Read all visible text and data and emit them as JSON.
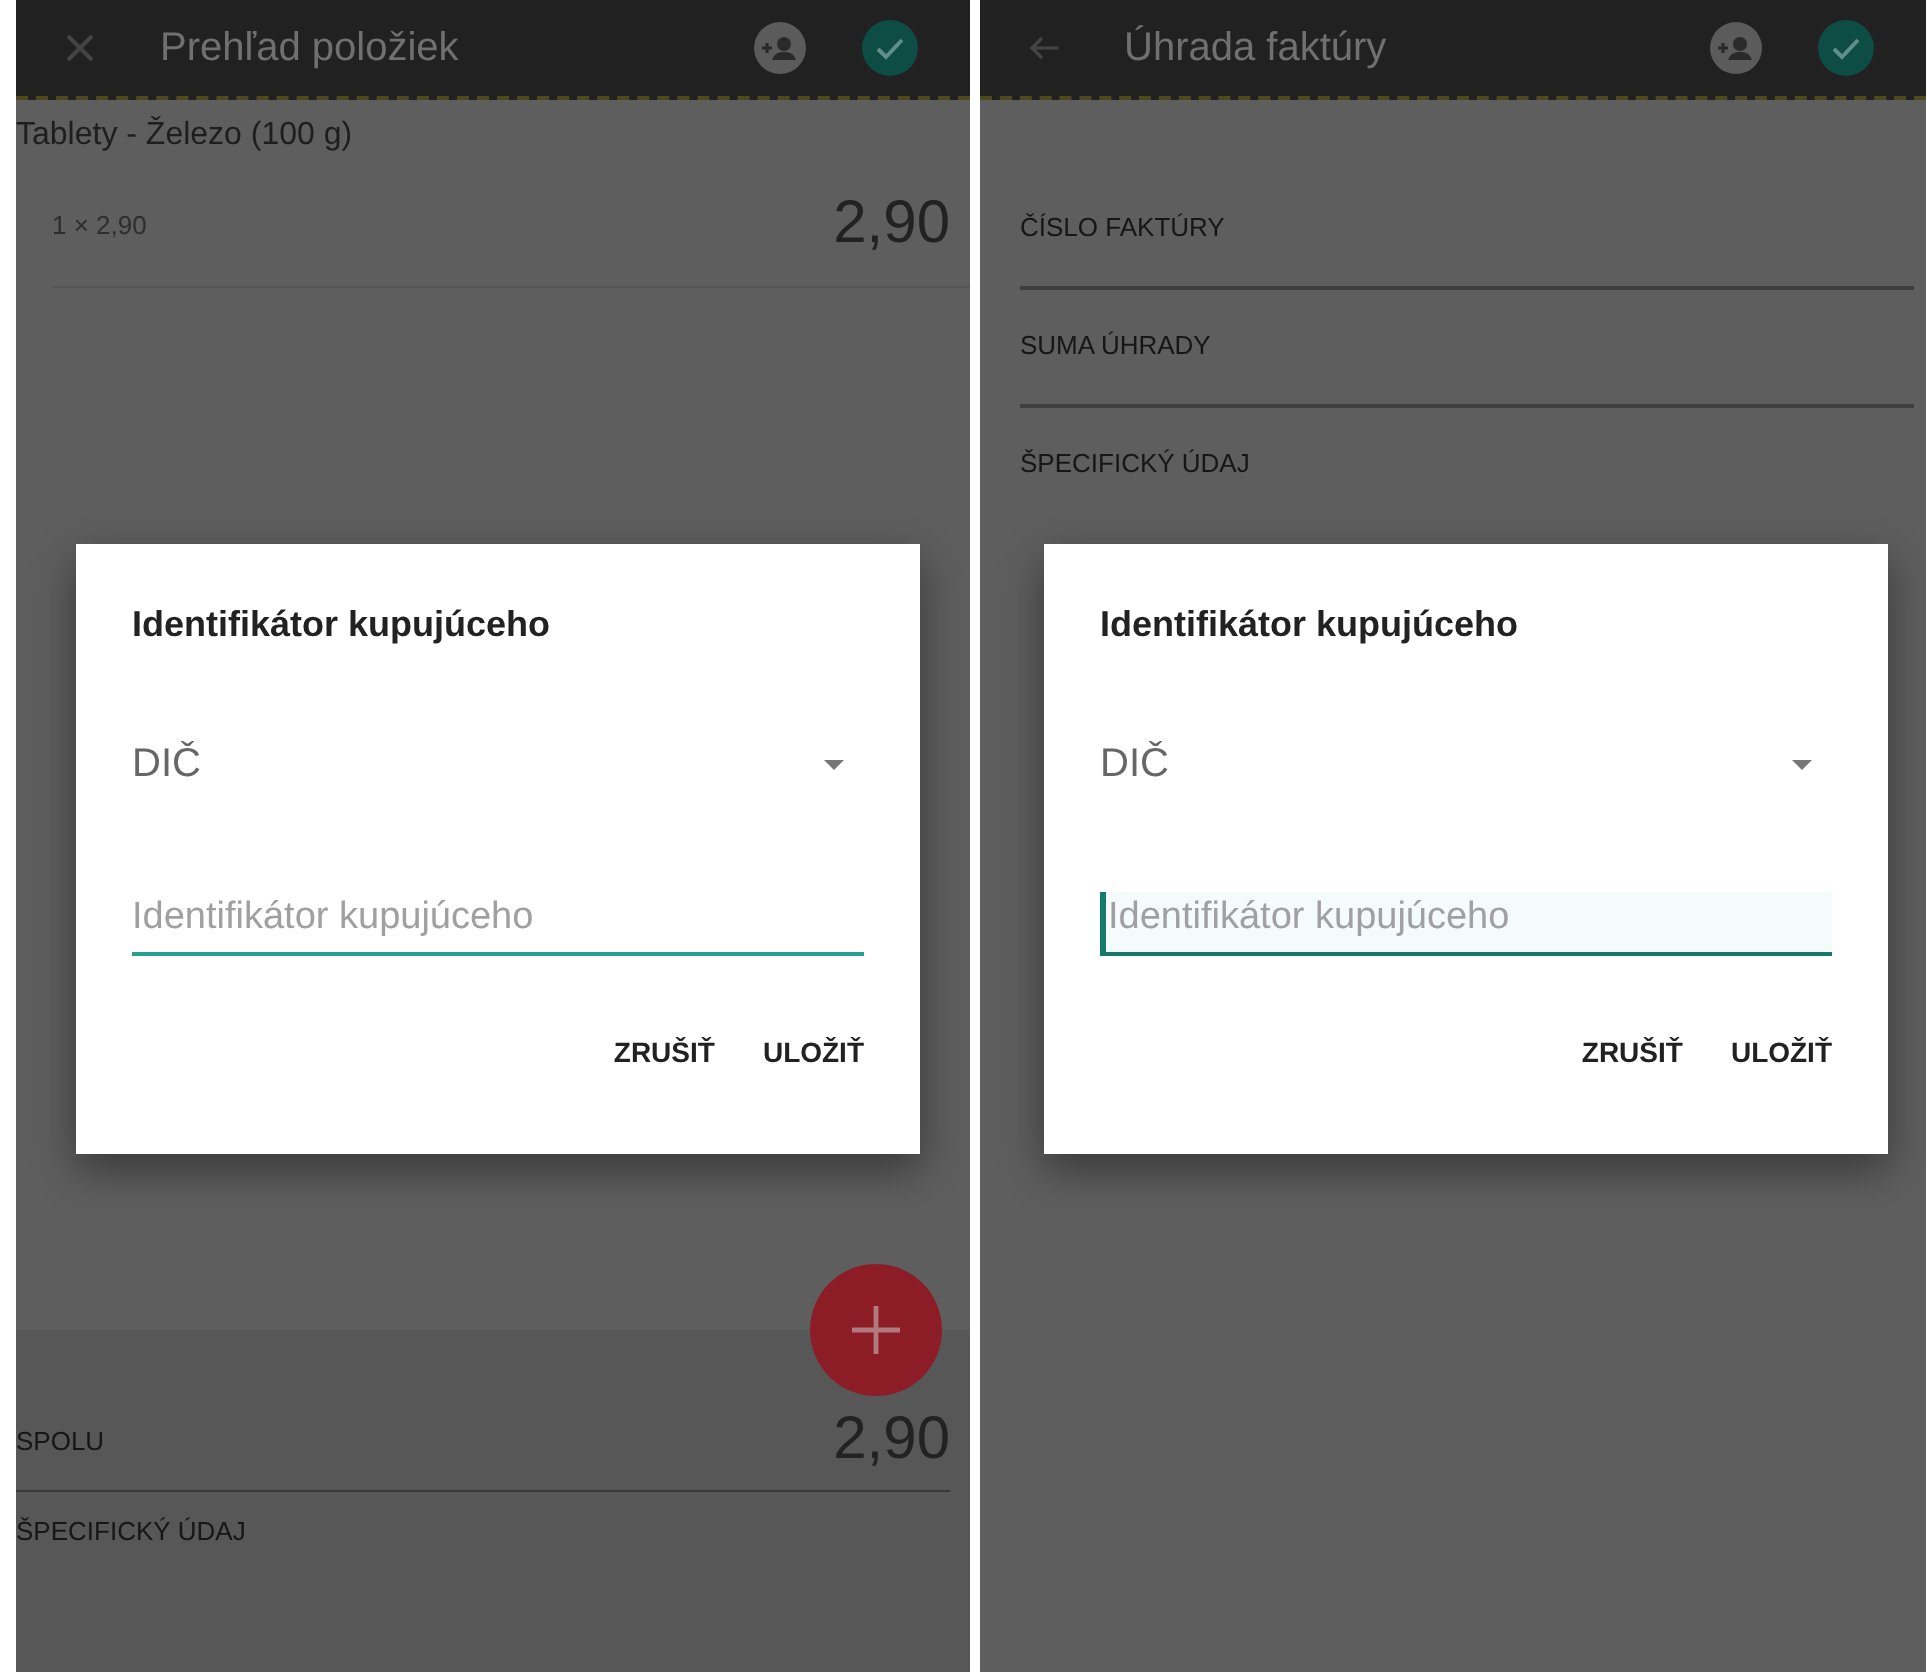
{
  "screens": [
    {
      "kind": "items",
      "toolbar": {
        "kind": "close",
        "title": "Prehľad položiek"
      },
      "item": {
        "name": "Tablety - Železo (100 g)",
        "quantity": "1 × 2,90",
        "total": "2,90"
      },
      "summary": {
        "label": "SPOLU",
        "total": "2,90",
        "note": "ŠPECIFICKÝ ÚDAJ"
      },
      "dialog": {
        "title": "Identifikátor kupujúceho",
        "select": "DIČ",
        "placeholder": "Identifikátor kupujúceho",
        "focused": false,
        "buttons": [
          "ZRUŠIŤ",
          "ULOŽIŤ"
        ]
      }
    },
    {
      "kind": "payment",
      "toolbar": {
        "kind": "back",
        "title": "Úhrada faktúry"
      },
      "fields": [
        "ČÍSLO FAKTÚRY",
        "SUMA ÚHRADY",
        "ŠPECIFICKÝ ÚDAJ"
      ],
      "dialog": {
        "title": "Identifikátor kupujúceho",
        "select": "DIČ",
        "placeholder": "Identifikátor kupujúceho",
        "focused": true,
        "buttons": [
          "ZRUŠIŤ",
          "ULOŽIŤ"
        ]
      }
    }
  ]
}
